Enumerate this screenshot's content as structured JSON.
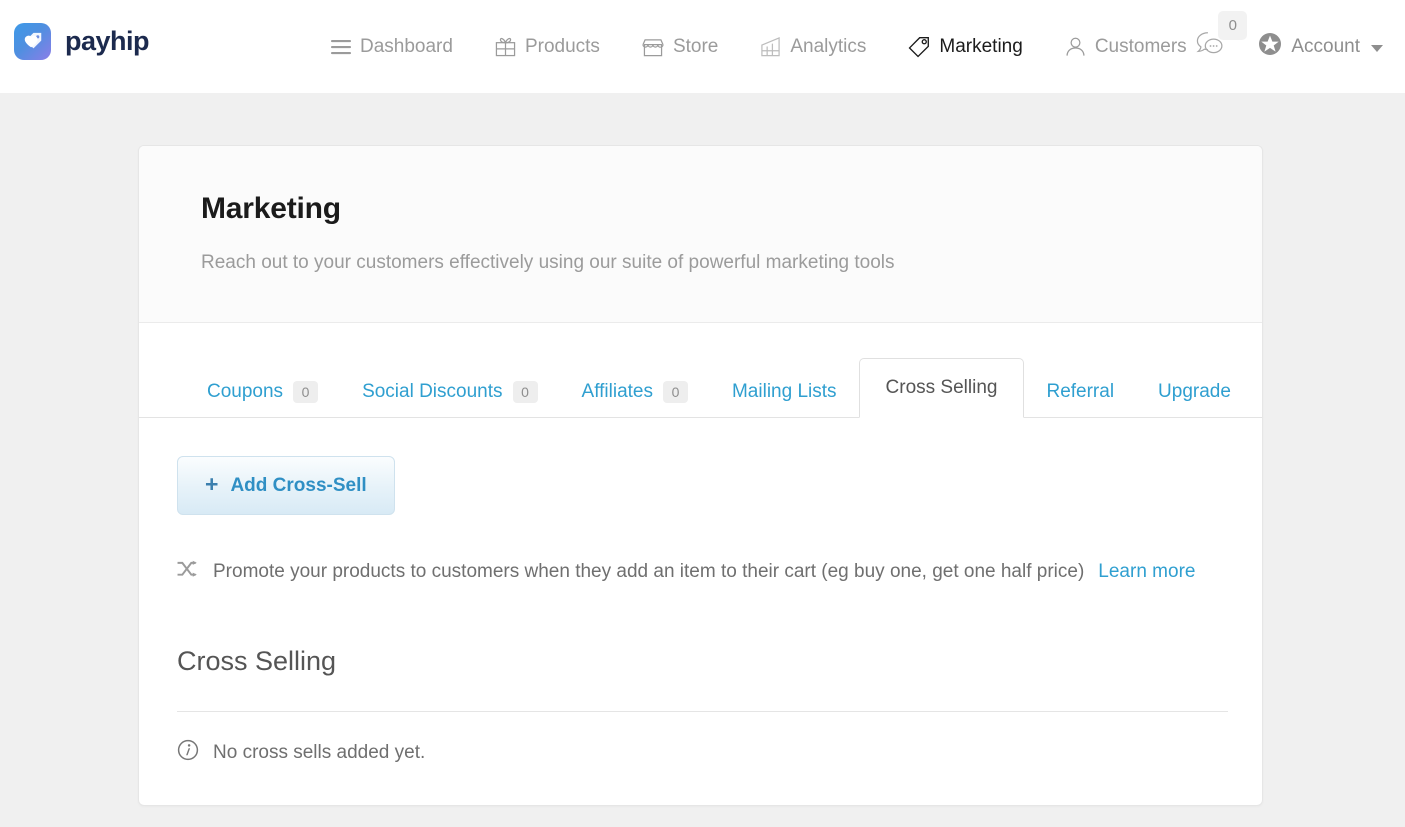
{
  "brand": {
    "name": "payhip",
    "logo_icon": "payhip-heart-tag-logo"
  },
  "nav": {
    "items": [
      {
        "label": "Dashboard",
        "icon": "hamburger-menu-icon",
        "active": false
      },
      {
        "label": "Products",
        "icon": "gift-box-icon",
        "active": false
      },
      {
        "label": "Store",
        "icon": "storefront-icon",
        "active": false
      },
      {
        "label": "Analytics",
        "icon": "bar-chart-icon",
        "active": false
      },
      {
        "label": "Marketing",
        "icon": "price-tag-icon",
        "active": true
      },
      {
        "label": "Customers",
        "icon": "person-icon",
        "active": false
      }
    ],
    "messages": {
      "icon": "chat-bubbles-icon",
      "badge_count": "0"
    },
    "account": {
      "label": "Account",
      "icon": "star-circle-icon",
      "caret": "chevron-down-icon"
    }
  },
  "header": {
    "title": "Marketing",
    "subtitle": "Reach out to your customers effectively using our suite of powerful marketing tools"
  },
  "tabs": [
    {
      "label": "Coupons",
      "count": "0",
      "active": false
    },
    {
      "label": "Social Discounts",
      "count": "0",
      "active": false
    },
    {
      "label": "Affiliates",
      "count": "0",
      "active": false
    },
    {
      "label": "Mailing Lists",
      "count": null,
      "active": false
    },
    {
      "label": "Cross Selling",
      "count": null,
      "active": true
    },
    {
      "label": "Referral",
      "count": null,
      "active": false
    },
    {
      "label": "Upgrade",
      "count": null,
      "active": false
    }
  ],
  "body": {
    "add_button": {
      "label": "Add Cross-Sell",
      "icon": "plus-icon"
    },
    "promo": {
      "icon": "shuffle-arrows-icon",
      "text": "Promote your products to customers when they add an item to their cart (eg buy one, get one half price)",
      "link_label": "Learn more"
    },
    "section_title": "Cross Selling",
    "empty_state": {
      "icon": "info-circle-icon",
      "text": "No cross sells added yet."
    }
  },
  "colors": {
    "page_background": "#f0f0f0",
    "card_background": "#ffffff",
    "link_blue": "#2f9fd0",
    "muted_text": "#9b9b9b",
    "body_text": "#6f6f6f",
    "heading_text": "#1b1b1b"
  }
}
